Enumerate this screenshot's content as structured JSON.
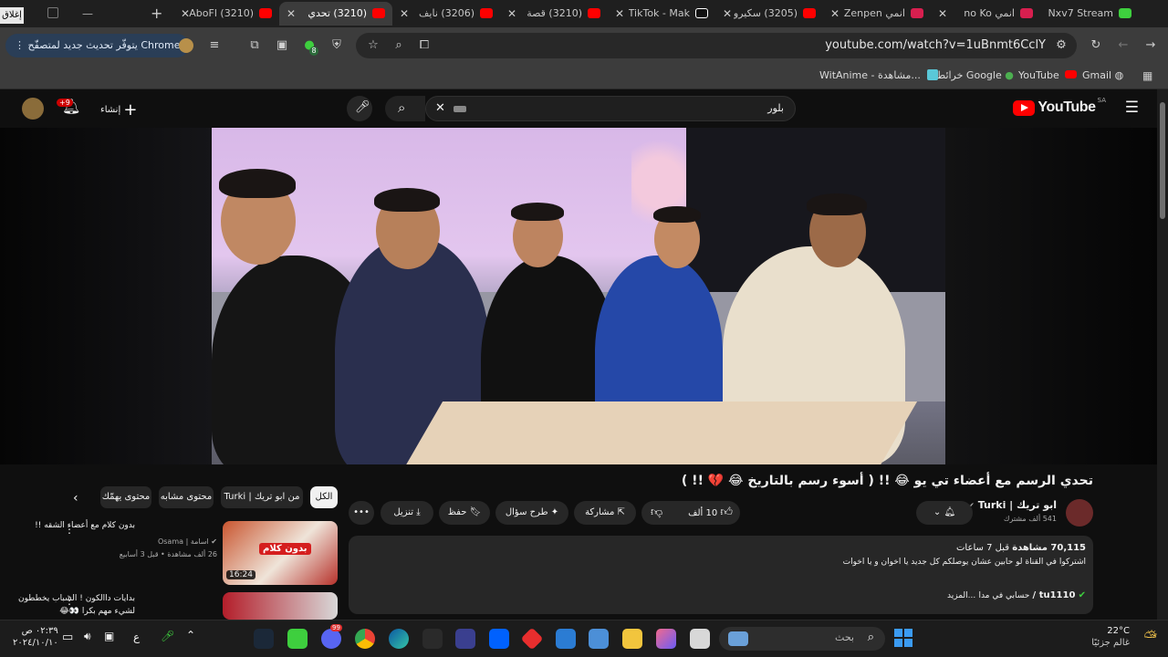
{
  "browser": {
    "close_label": "إغلاق",
    "tabs": [
      {
        "label": "Nxv7 Stream",
        "color": "#3ecf3e"
      },
      {
        "label": "انمي no Ko",
        "color": "#d81f4f"
      },
      {
        "label": "انمي Zenpen",
        "color": "#d81f4f"
      },
      {
        "label": "(3205) سكيرو",
        "color": "#ff0000"
      },
      {
        "label": "TikTok - Mak",
        "color": "#ffffff"
      },
      {
        "label": "(3210) قصة",
        "color": "#ff0000"
      },
      {
        "label": "(3206) نايف",
        "color": "#ff0000"
      },
      {
        "label": "(3210) تحدي",
        "color": "#ff0000",
        "active": true
      },
      {
        "label": "(3210) AboFl",
        "color": "#ff0000"
      }
    ],
    "update_label": "يتوفّر تحديث جديد لمتصفّح Chrome",
    "url": "youtube.com/watch?v=1uBnmt6CclY",
    "extension_badge": "8",
    "bookmarks": [
      {
        "label": "Gmail",
        "icon": "gmail-icon"
      },
      {
        "label": "YouTube",
        "icon": "youtube-icon"
      },
      {
        "label": "خرائط Google",
        "icon": "maps-icon"
      },
      {
        "label": "WitAnime - مشاهدة...",
        "icon": "witanime-icon"
      }
    ]
  },
  "youtube": {
    "logo_text": "YouTube",
    "country_code": "SA",
    "search_value": "بلور",
    "create_label": "إنشاء",
    "notification_count": "+9",
    "video": {
      "title": "تحدي الرسم مع أعضاء تي يو 😂 !! ( أسوء رسم بالتاريخ 😂 💔 !! )",
      "channel_name": "ابو تريك | Turki",
      "subscribers": "541 ألف مشترك",
      "likes": "10 ألف",
      "share_label": "مشاركة",
      "ask_label": "طرح سؤال",
      "save_label": "حفظ",
      "download_label": "تنزيل",
      "views": "70,115 مشاهدة",
      "time_ago": "قبل 7 ساعات",
      "description": "اشتركوا في القناة لو حابين عشان يوصلكم كل جديد يا اخوان و يا اخوات",
      "description_tail": "...المزيد",
      "pinned_channel": "tu1110 /",
      "pinned_text": "حسابي في مدا"
    },
    "chips": [
      "الكل",
      "من ابو تريك | Turki",
      "محتوى مشابه",
      "محتوى يهمّك"
    ],
    "recommendations": [
      {
        "title": "بدون كلام مع أعضاء الشقه !!",
        "channel": "Osama | اسامة",
        "meta": "26 ألف مشاهدة • قبل 3 أسابيع",
        "duration": "16:24",
        "thumb_text": "بدون كلام"
      },
      {
        "title": "بدايات داالكون ! الشباب يخططون لشيء مهم بكرا 👀😂",
        "channel": "",
        "meta": "",
        "duration": "",
        "thumb_text": ""
      }
    ]
  },
  "taskbar": {
    "search_placeholder": "بحث",
    "weather_temp": "22°C",
    "weather_text": "غالم جزئيًا",
    "time": "٠٢:٣٩ ص",
    "date": "٢٠٢٤/١٠/١٠",
    "lang": "ع",
    "discord_badge": "99"
  }
}
